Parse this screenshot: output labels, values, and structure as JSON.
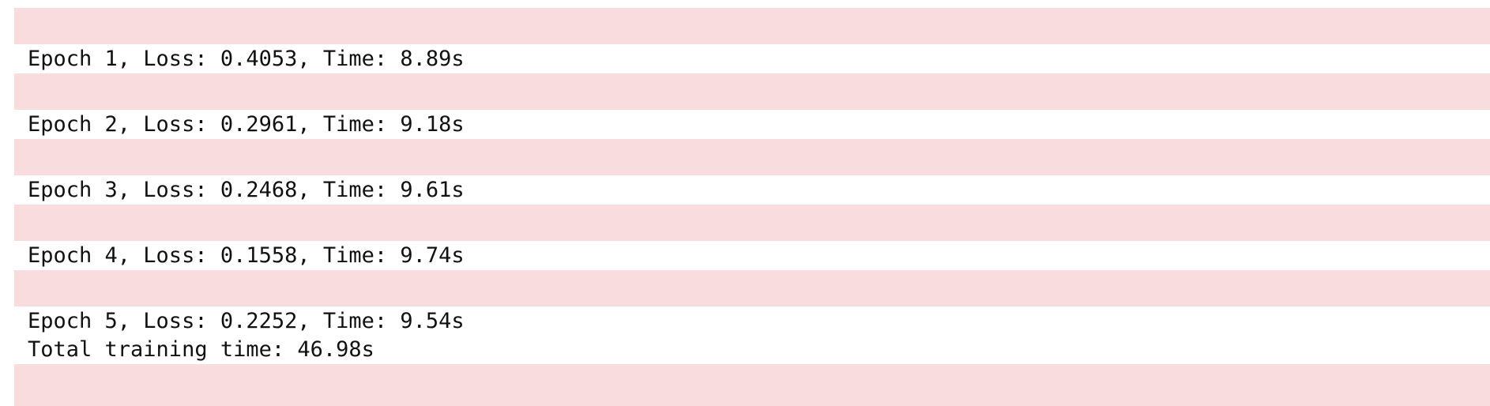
{
  "output": {
    "epochs": [
      "Epoch 1, Loss: 0.4053, Time: 8.89s",
      "Epoch 2, Loss: 0.2961, Time: 9.18s",
      "Epoch 3, Loss: 0.2468, Time: 9.61s",
      "Epoch 4, Loss: 0.1558, Time: 9.74s",
      "Epoch 5, Loss: 0.2252, Time: 9.54s"
    ],
    "total": "Total training time: 46.98s"
  },
  "colors": {
    "stderr_band": "#f9dcde",
    "text": "#111111",
    "background": "#ffffff"
  }
}
